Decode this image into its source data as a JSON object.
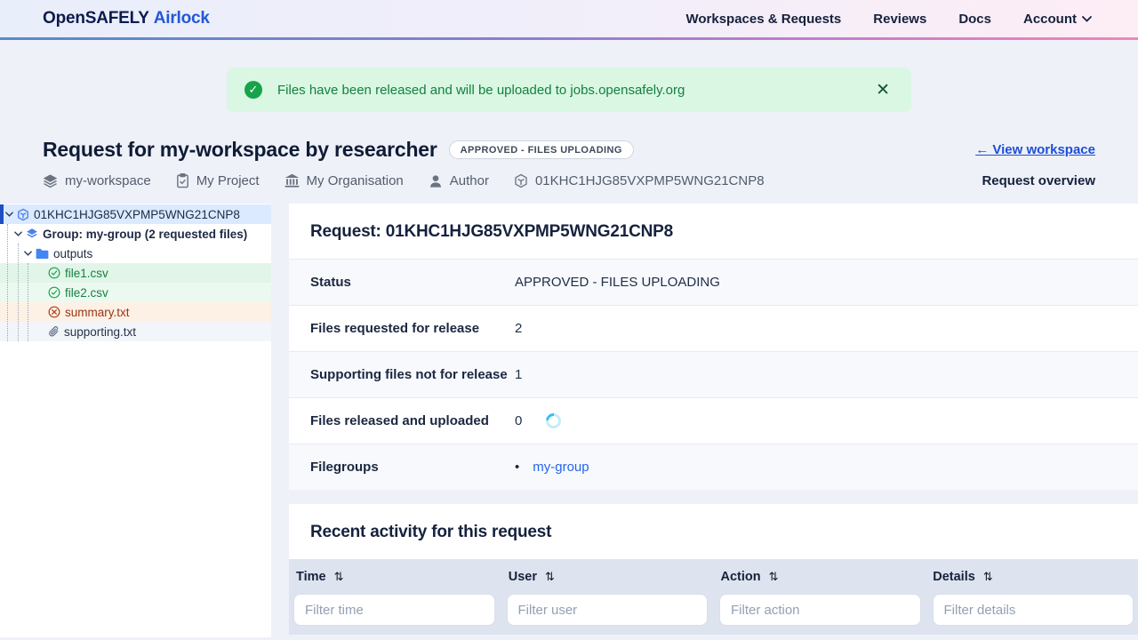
{
  "header": {
    "logo_primary": "OpenSAFELY",
    "logo_secondary": "Airlock",
    "nav": [
      {
        "label": "Workspaces & Requests"
      },
      {
        "label": "Reviews"
      },
      {
        "label": "Docs"
      },
      {
        "label": "Account"
      }
    ]
  },
  "notification": {
    "message": "Files have been released and will be uploaded to jobs.opensafely.org",
    "close_glyph": "✕",
    "check_glyph": "✓"
  },
  "page_header": {
    "title": "Request for my-workspace by researcher",
    "status_badge": "APPROVED - FILES UPLOADING",
    "back_link": "← View workspace",
    "overview_label": "Request overview",
    "meta": [
      {
        "icon": "layers-icon",
        "label": "my-workspace"
      },
      {
        "icon": "clipboard-icon",
        "label": "My Project"
      },
      {
        "icon": "organisation-icon",
        "label": "My Organisation"
      },
      {
        "icon": "user-icon",
        "label": "Author"
      },
      {
        "icon": "request-icon",
        "label": "01KHC1HJG85VXPMP5WNG21CNP8"
      }
    ]
  },
  "sidebar": {
    "root": {
      "label": "01KHC1HJG85VXPMP5WNG21CNP8"
    },
    "group": {
      "label": "Group: my-group (2 requested files)"
    },
    "folder": {
      "label": "outputs"
    },
    "files": [
      {
        "name": "file1.csv",
        "state": "approved"
      },
      {
        "name": "file2.csv",
        "state": "approved"
      },
      {
        "name": "summary.txt",
        "state": "rejected"
      },
      {
        "name": "supporting.txt",
        "state": "supporting"
      }
    ]
  },
  "main": {
    "request_heading": "Request: 01KHC1HJG85VXPMP5WNG21CNP8",
    "details": [
      {
        "label": "Status",
        "value": "APPROVED - FILES UPLOADING"
      },
      {
        "label": "Files requested for release",
        "value": "2"
      },
      {
        "label": "Supporting files not for release",
        "value": "1"
      },
      {
        "label": "Files released and uploaded",
        "value": "0",
        "spinner": true
      },
      {
        "label": "Filegroups",
        "value": "my-group",
        "link": true
      }
    ],
    "activity": {
      "heading": "Recent activity for this request",
      "sort_glyph": "⇅",
      "columns": [
        {
          "label": "Time",
          "filter_placeholder": "Filter time"
        },
        {
          "label": "User",
          "filter_placeholder": "Filter user"
        },
        {
          "label": "Action",
          "filter_placeholder": "Filter action"
        },
        {
          "label": "Details",
          "filter_placeholder": "Filter details"
        }
      ]
    }
  },
  "colors": {
    "success_green": "#17a34a",
    "link_blue": "#1d4ed8",
    "approved_file_green": "#15803d",
    "rejected_file_red": "#9a3412",
    "selected_tree_blue": "#dbeafe",
    "table_head_bg": "#dde4ef"
  }
}
